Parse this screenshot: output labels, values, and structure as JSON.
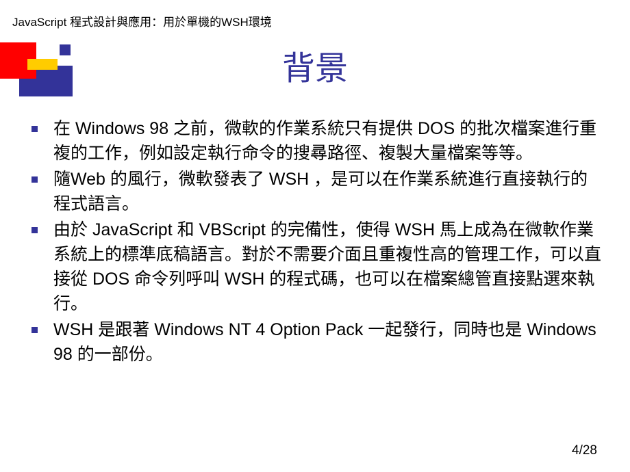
{
  "header": "JavaScript 程式設計與應用：用於單機的WSH環境",
  "title": "背景",
  "bullets": [
    "在 Windows 98 之前，微軟的作業系統只有提供 DOS 的批次檔案進行重複的工作，例如設定執行命令的搜尋路徑、複製大量檔案等等。",
    "隨Web 的風行，微軟發表了 WSH ，是可以在作業系統進行直接執行的程式語言。",
    "由於 JavaScript 和 VBScript 的完備性，使得 WSH 馬上成為在微軟作業系統上的標準底稿語言。對於不需要介面且重複性高的管理工作，可以直接從 DOS 命令列呼叫 WSH 的程式碼，也可以在檔案總管直接點選來執行。",
    "WSH 是跟著 Windows NT 4 Option Pack 一起發行，同時也是 Windows 98 的一部份。"
  ],
  "page": {
    "current": 4,
    "total": 28,
    "display": "4/28"
  }
}
